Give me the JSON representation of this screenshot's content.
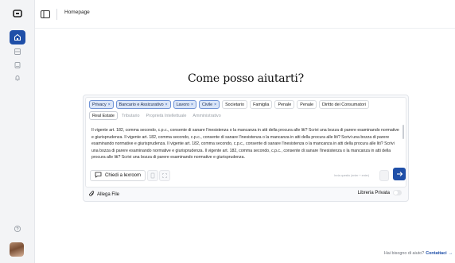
{
  "topbar": {
    "breadcrumb": "Homepage"
  },
  "heading": "Come posso aiutarti?",
  "tags": {
    "row1": [
      {
        "label": "Privacy",
        "selected": true
      },
      {
        "label": "Bancario e Assicurativo",
        "selected": true
      },
      {
        "label": "Lavoro",
        "selected": true
      },
      {
        "label": "Civile",
        "selected": true
      },
      {
        "label": "Societario",
        "selected": false
      },
      {
        "label": "Famiglia",
        "selected": false
      },
      {
        "label": "Penale",
        "selected": false
      },
      {
        "label": "Penale",
        "selected": false
      },
      {
        "label": "Diritto dei Consumatori",
        "selected": false
      }
    ],
    "row2": [
      {
        "label": "Real Estate",
        "state": "active"
      },
      {
        "label": "Tributario",
        "state": "muted"
      },
      {
        "label": "Proprietà Intellettuale",
        "state": "muted"
      },
      {
        "label": "Amministrativo",
        "state": "muted"
      }
    ],
    "remove_glyph": "×"
  },
  "prompt_text": "Il vigente art. 182, comma secondo, c.p.c., consente di sanare l'inesistenza o la mancanza in atti della procura alle liti? Scrivi una bozza di parere esaminando normative e giurisprudenza. Il vigente art. 182, comma secondo, c.p.c., consente di sanare l'inesistenza o la mancanza in atti della procura alle liti? Scrivi una bozza di parere esaminando normative e giurisprudenza. Il vigente art. 182, comma secondo, c.p.c., consente di sanare l'inesistenza o la mancanza in atti della procura alle liti? Scrivi una bozza di parere esaminando normative e giurisprudenza. Il vigente art. 182, comma secondo, c.p.c., consente di sanare l'inesistenza o la mancanza in atti della procura alle liti? Scrivi una bozza di parere esaminando normative e giurisprudenza.",
  "composer": {
    "lexroom_label": "Chiedi a lexroom",
    "hint": "Invia quesito (enter + enter)",
    "attach_label": "Allega File",
    "library_label": "Libreria Privata"
  },
  "footer": {
    "help_text": "Hai bisogno di aiuto?",
    "contact_label": "Contattaci",
    "arrow": "→"
  },
  "colors": {
    "accent": "#1f4fa8",
    "tag_selected_bg": "#dbe6f8"
  },
  "icons": [
    "app-logo-icon",
    "home-icon",
    "archive-icon",
    "document-icon",
    "bell-icon",
    "help-icon",
    "sidebar-toggle-icon",
    "chat-icon",
    "file-icon",
    "expand-icon",
    "send-arrow-icon",
    "paperclip-icon"
  ]
}
